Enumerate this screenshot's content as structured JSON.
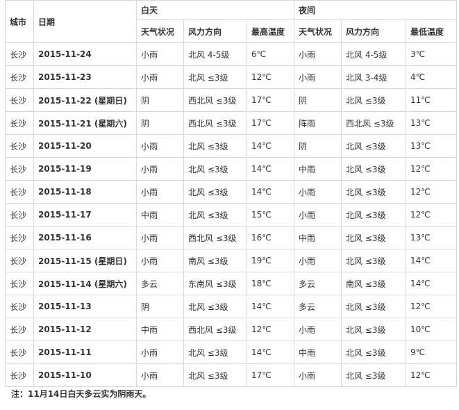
{
  "headers": {
    "city": "城市",
    "date": "日期",
    "day": "白天",
    "night": "夜间",
    "day_cols": [
      "天气状况",
      "风力方向",
      "最高温度"
    ],
    "night_cols": [
      "天气状况",
      "风力方向",
      "最低温度"
    ]
  },
  "rows": [
    {
      "city": "长沙",
      "date": "2015-11-24",
      "day_weather": "小雨",
      "day_wind": "北风 4-5级",
      "high": "6℃",
      "night_weather": "小雨",
      "night_wind": "北风 4-5级",
      "low": "3℃"
    },
    {
      "city": "长沙",
      "date": "2015-11-23",
      "day_weather": "小雨",
      "day_wind": "北风 ≤3级",
      "high": "12℃",
      "night_weather": "小雨",
      "night_wind": "北风 3-4级",
      "low": "4℃"
    },
    {
      "city": "长沙",
      "date": "2015-11-22 (星期日)",
      "day_weather": "阴",
      "day_wind": "西北风 ≤3级",
      "high": "17℃",
      "night_weather": "阴",
      "night_wind": "北风 ≤3级",
      "low": "11℃"
    },
    {
      "city": "长沙",
      "date": "2015-11-21 (星期六)",
      "day_weather": "阴",
      "day_wind": "西北风 ≤3级",
      "high": "17℃",
      "night_weather": "阵雨",
      "night_wind": "西北风 ≤3级",
      "low": "13℃"
    },
    {
      "city": "长沙",
      "date": "2015-11-20",
      "day_weather": "小雨",
      "day_wind": "北风 ≤3级",
      "high": "14℃",
      "night_weather": "阴",
      "night_wind": "北风 ≤3级",
      "low": "13℃"
    },
    {
      "city": "长沙",
      "date": "2015-11-19",
      "day_weather": "小雨",
      "day_wind": "北风 ≤3级",
      "high": "14℃",
      "night_weather": "中雨",
      "night_wind": "北风 ≤3级",
      "low": "12℃"
    },
    {
      "city": "长沙",
      "date": "2015-11-18",
      "day_weather": "小雨",
      "day_wind": "北风 ≤3级",
      "high": "14℃",
      "night_weather": "小雨",
      "night_wind": "北风 ≤3级",
      "low": "12℃"
    },
    {
      "city": "长沙",
      "date": "2015-11-17",
      "day_weather": "中雨",
      "day_wind": "北风 ≤3级",
      "high": "15℃",
      "night_weather": "小雨",
      "night_wind": "北风 ≤3级",
      "low": "12℃"
    },
    {
      "city": "长沙",
      "date": "2015-11-16",
      "day_weather": "小雨",
      "day_wind": "西北风 ≤3级",
      "high": "16℃",
      "night_weather": "中雨",
      "night_wind": "北风 ≤3级",
      "low": "13℃"
    },
    {
      "city": "长沙",
      "date": "2015-11-15 (星期日)",
      "day_weather": "小雨",
      "day_wind": "南风 ≤3级",
      "high": "19℃",
      "night_weather": "小雨",
      "night_wind": "北风 ≤3级",
      "low": "14℃"
    },
    {
      "city": "长沙",
      "date": "2015-11-14 (星期六)",
      "day_weather": "多云",
      "day_wind": "东南风 ≤3级",
      "high": "18℃",
      "night_weather": "多云",
      "night_wind": "南风 ≤3级",
      "low": "14℃"
    },
    {
      "city": "长沙",
      "date": "2015-11-13",
      "day_weather": "阴",
      "day_wind": "北风 ≤3级",
      "high": "14℃",
      "night_weather": "多云",
      "night_wind": "北风 ≤3级",
      "low": "12℃"
    },
    {
      "city": "长沙",
      "date": "2015-11-12",
      "day_weather": "中雨",
      "day_wind": "西北风 ≤3级",
      "high": "12℃",
      "night_weather": "小雨",
      "night_wind": "北风 ≤3级",
      "low": "10℃"
    },
    {
      "city": "长沙",
      "date": "2015-11-11",
      "day_weather": "小雨",
      "day_wind": "北风 ≤3级",
      "high": "14℃",
      "night_weather": "中雨",
      "night_wind": "北风 ≤3级",
      "low": "9℃"
    },
    {
      "city": "长沙",
      "date": "2015-11-10",
      "day_weather": "小雨",
      "day_wind": "北风 ≤3级",
      "high": "17℃",
      "night_weather": "小雨",
      "night_wind": "北风 ≤3级",
      "low": "12℃"
    }
  ],
  "note": "注：11月14日白天多云实为阴雨天。"
}
